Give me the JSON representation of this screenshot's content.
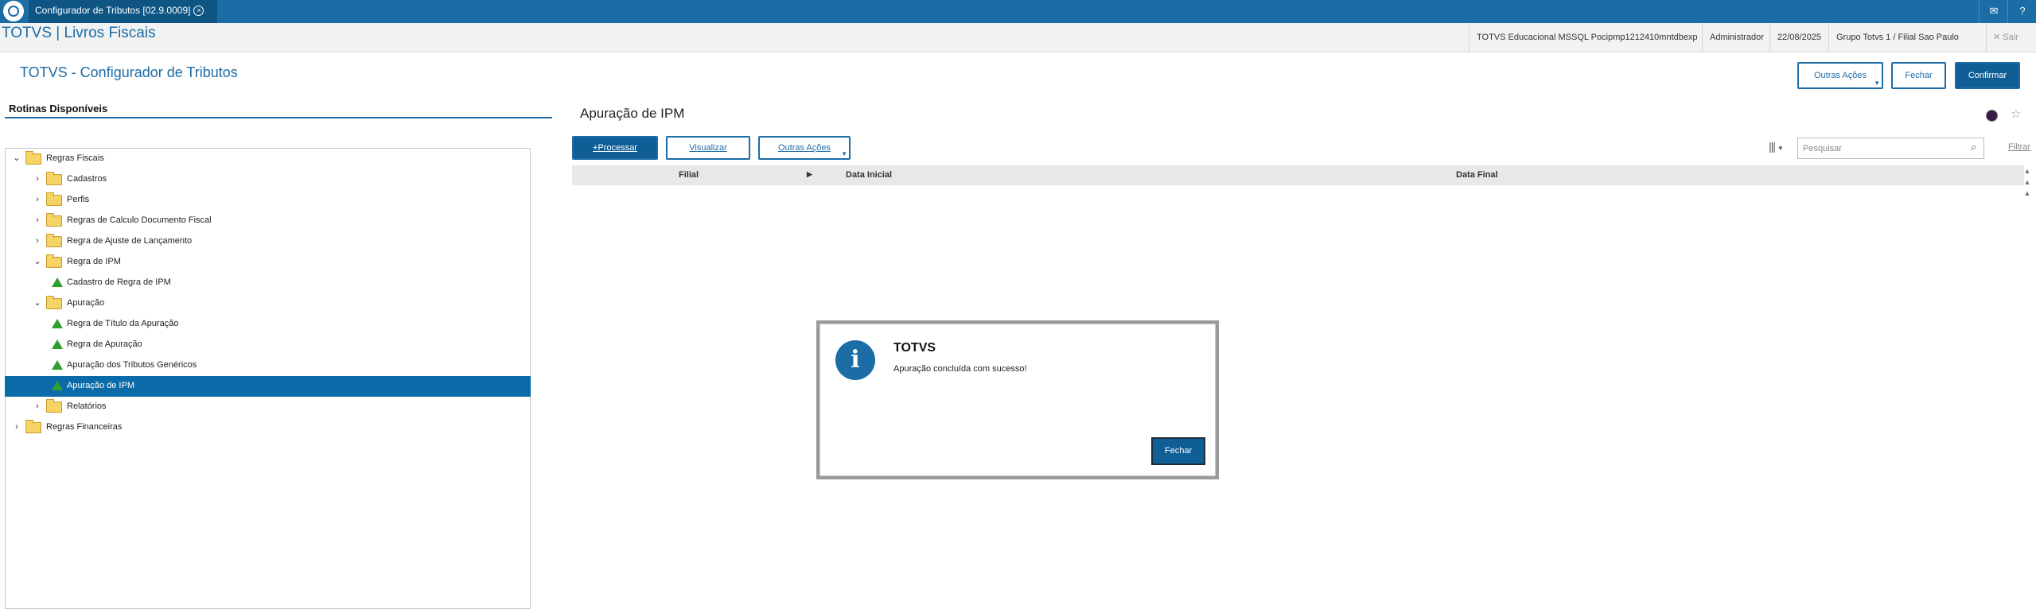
{
  "topbar": {
    "tab_title": "Configurador de Tributos [02.9.0009]",
    "tab_close": "x",
    "mail_icon": "mail-icon",
    "help_icon": "help-icon"
  },
  "header": {
    "brand": "TOTVS | Livros Fiscais",
    "environment": "TOTVS Educacional MSSQL Pocipmp1212410mntdbexp",
    "user": "Administrador",
    "date": "22/08/2025",
    "company": "Grupo Totvs 1 / Filial Sao Paulo",
    "logout": "Sair"
  },
  "page": {
    "title": "TOTVS - Configurador de Tributos",
    "actions": {
      "other": "Outras Ações",
      "close": "Fechar",
      "confirm": "Confirmar"
    }
  },
  "left": {
    "title": "Rotinas Disponíveis",
    "tree": [
      {
        "label": "Regras Fiscais",
        "level": 0,
        "type": "folder",
        "expanded": true
      },
      {
        "label": "Cadastros",
        "level": 1,
        "type": "folder",
        "expanded": false
      },
      {
        "label": "Perfis",
        "level": 1,
        "type": "folder",
        "expanded": false
      },
      {
        "label": "Regras de Calculo Documento Fiscal",
        "level": 1,
        "type": "folder",
        "expanded": false
      },
      {
        "label": "Regra de Ajuste de Lançamento",
        "level": 1,
        "type": "folder",
        "expanded": false
      },
      {
        "label": "Regra de IPM",
        "level": 1,
        "type": "folder",
        "expanded": true
      },
      {
        "label": "Cadastro de Regra de IPM",
        "level": 2,
        "type": "item"
      },
      {
        "label": "Apuração",
        "level": 1,
        "type": "folder",
        "expanded": true
      },
      {
        "label": "Regra de Título da Apuração",
        "level": 2,
        "type": "item"
      },
      {
        "label": "Regra de Apuração",
        "level": 2,
        "type": "item"
      },
      {
        "label": "Apuração dos Tributos Genéricos",
        "level": 2,
        "type": "item"
      },
      {
        "label": "Apuração de IPM",
        "level": 2,
        "type": "item",
        "selected": true
      },
      {
        "label": "Relatórios",
        "level": 1,
        "type": "folder",
        "expanded": false
      },
      {
        "label": "Regras Financeiras",
        "level": 0,
        "type": "folder",
        "expanded": false
      }
    ]
  },
  "right": {
    "title": "Apuração de IPM",
    "toolbar": {
      "process": "Processar",
      "view": "Visualizar",
      "other": "Outras Ações"
    },
    "search_placeholder": "Pesquisar",
    "filter": "Filtrar",
    "columns": [
      "Filial",
      "Data Inicial",
      "Data Final"
    ]
  },
  "modal": {
    "title": "TOTVS",
    "message": "Apuração concluída com sucesso!",
    "button": "Fechar",
    "icon": "i"
  },
  "colors": {
    "brand": "#1c6ca6",
    "selected": "#0b6ba9",
    "primary_button": "#0f5e96"
  }
}
